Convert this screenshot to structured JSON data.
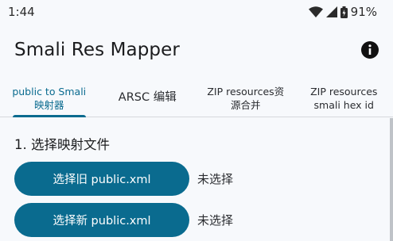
{
  "status_bar": {
    "time": "1:44",
    "battery": "91%"
  },
  "app": {
    "title": "Smali Res Mapper",
    "info_icon": "info-icon"
  },
  "tabs": [
    {
      "line1": "public to Smali",
      "line2": "映射器",
      "active": true
    },
    {
      "line1": "ARSC 编辑",
      "line2": "",
      "active": false
    },
    {
      "line1": "ZIP resources资",
      "line2": "源合并",
      "active": false
    },
    {
      "line1": "ZIP resources",
      "line2": "smali hex id",
      "active": false
    }
  ],
  "section": {
    "title": "1. 选择映射文件"
  },
  "rows": [
    {
      "button_label": "选择旧 public.xml",
      "status": "未选择"
    },
    {
      "button_label": "选择新 public.xml",
      "status": "未选择"
    }
  ],
  "colors": {
    "accent": "#0a6b8f",
    "background": "#f7f9fc"
  }
}
